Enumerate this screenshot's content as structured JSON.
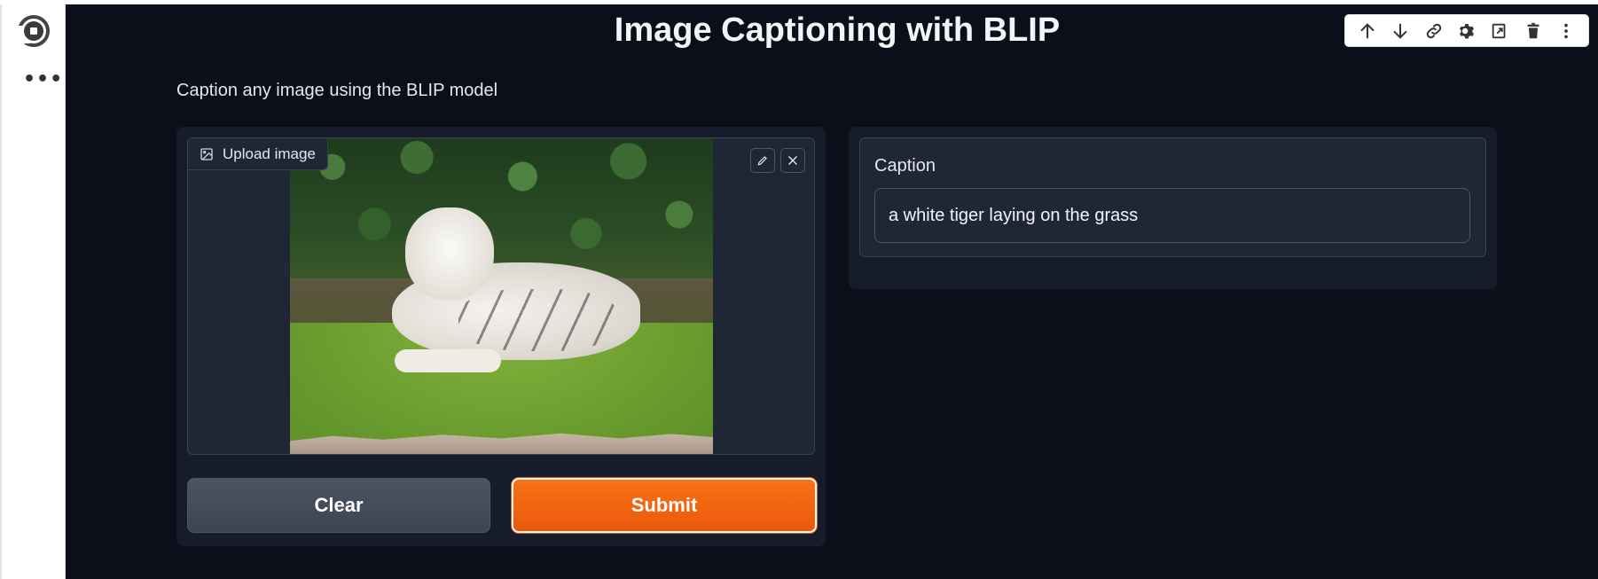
{
  "app": {
    "title": "Image Captioning with BLIP",
    "description": "Caption any image using the BLIP model"
  },
  "toolbar": {
    "icons": [
      "arrow-up-icon",
      "arrow-down-icon",
      "link-icon",
      "gear-icon",
      "embed-icon",
      "trash-icon",
      "more-vertical-icon"
    ]
  },
  "image_input": {
    "label": "Upload image",
    "image_subject": "white tiger on grass"
  },
  "buttons": {
    "clear": "Clear",
    "submit": "Submit"
  },
  "output": {
    "label": "Caption",
    "value": "a white tiger laying on the grass"
  },
  "colors": {
    "background": "#0b0f19",
    "panel": "#161c2b",
    "accent": "#f97316",
    "secondary_button": "#4b5563"
  }
}
